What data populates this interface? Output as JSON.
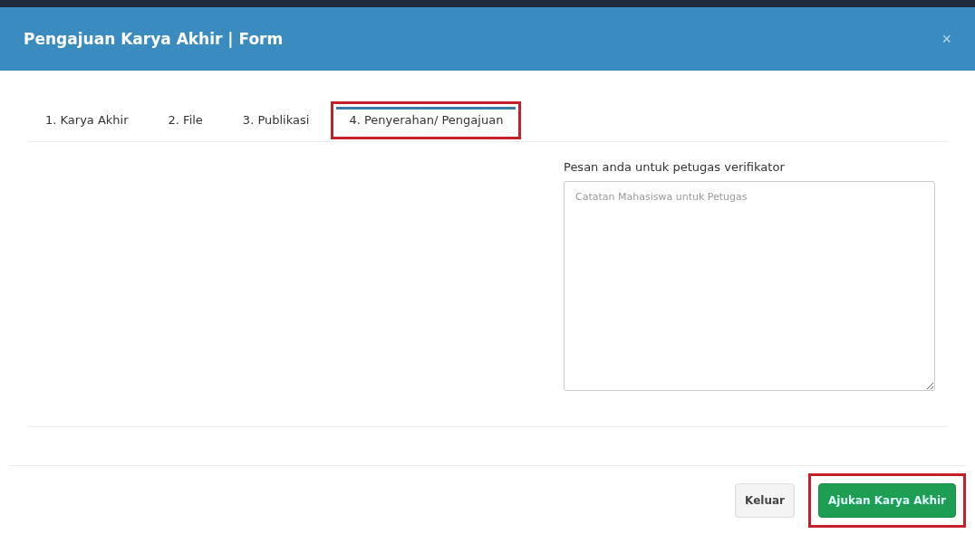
{
  "modal": {
    "title": "Pengajuan Karya Akhir | Form",
    "close": "×"
  },
  "tabs": [
    {
      "label": "1. Karya Akhir",
      "selected": false,
      "highlighted": false
    },
    {
      "label": "2. File",
      "selected": false,
      "highlighted": false
    },
    {
      "label": "3. Publikasi",
      "selected": false,
      "highlighted": false
    },
    {
      "label": "4. Penyerahan/ Pengajuan",
      "selected": true,
      "highlighted": true
    }
  ],
  "message": {
    "label": "Pesan anda untuk petugas verifikator",
    "placeholder": "Catatan Mahasiswa untuk Petugas"
  },
  "buttons": [
    {
      "label": "Keluar",
      "kind": "default",
      "highlighted": false
    },
    {
      "label": "Ajukan Karya Akhir",
      "kind": "primary",
      "highlighted": true
    }
  ]
}
